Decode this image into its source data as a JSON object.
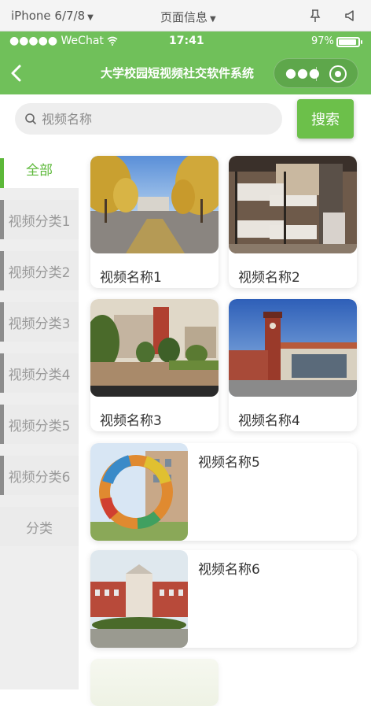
{
  "devtools": {
    "device": "iPhone 6/7/8",
    "page_info": "页面信息"
  },
  "status": {
    "carrier": "●●●●● WeChat",
    "time": "17:41",
    "battery": "97%"
  },
  "nav": {
    "title": "大学校园短视频社交软件系统"
  },
  "search": {
    "placeholder": "视频名称",
    "button": "搜索"
  },
  "categories": [
    {
      "label": "全部"
    },
    {
      "label": "视频分类1"
    },
    {
      "label": "视频分类2"
    },
    {
      "label": "视频分类3"
    },
    {
      "label": "视频分类4"
    },
    {
      "label": "视频分类5"
    },
    {
      "label": "视频分类6"
    },
    {
      "label": "分类"
    }
  ],
  "videos": [
    {
      "name": "视频名称1"
    },
    {
      "name": "视频名称2"
    },
    {
      "name": "视频名称3"
    },
    {
      "name": "视频名称4"
    },
    {
      "name": "视频名称5"
    },
    {
      "name": "视频名称6"
    }
  ],
  "colors": {
    "brand_green": "#70c05a",
    "active_green": "#5cb839",
    "button_green": "#6cc04a"
  }
}
